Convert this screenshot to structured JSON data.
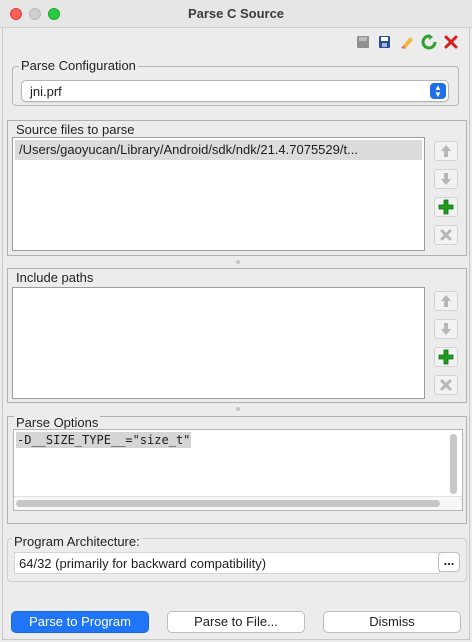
{
  "window": {
    "title": "Parse C Source"
  },
  "toolbar": {
    "icons": [
      "save-icon",
      "save-as-icon",
      "clear-icon",
      "refresh-icon",
      "delete-icon"
    ]
  },
  "parse_configuration": {
    "label": "Parse Configuration",
    "selected": "jni.prf"
  },
  "source_files": {
    "label": "Source files to parse",
    "items": [
      "/Users/gaoyucan/Library/Android/sdk/ndk/21.4.7075529/t..."
    ]
  },
  "include_paths": {
    "label": "Include paths",
    "items": []
  },
  "parse_options": {
    "label": "Parse Options",
    "value": "-D__SIZE_TYPE__=\"size_t\""
  },
  "program_architecture": {
    "label": "Program Architecture:",
    "value": "64/32 (primarily for backward compatibility)",
    "button": "..."
  },
  "buttons": {
    "parse_to_program": "Parse to Program",
    "parse_to_file": "Parse to File...",
    "dismiss": "Dismiss"
  },
  "colors": {
    "accent": "#1f75f5",
    "add_green": "#1f9e22",
    "delete_red": "#d91c1c"
  }
}
